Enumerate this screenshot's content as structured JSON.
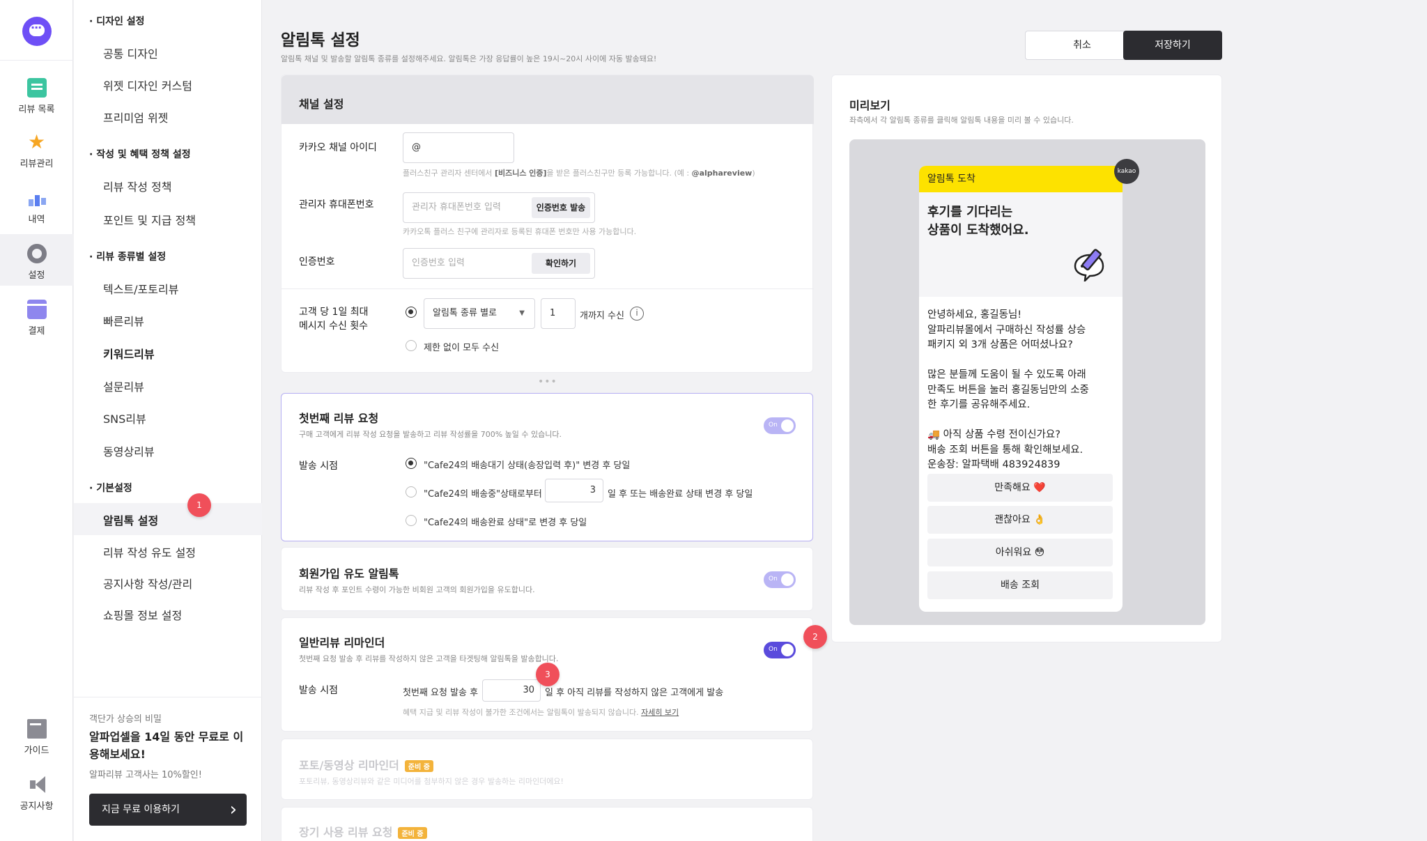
{
  "rail": {
    "items": [
      {
        "label": "리뷰 목록",
        "icon": "review-list-icon"
      },
      {
        "label": "리뷰관리",
        "icon": "star-icon"
      },
      {
        "label": "내역",
        "icon": "bar-chart-icon"
      },
      {
        "label": "설정",
        "icon": "gear-icon"
      },
      {
        "label": "결제",
        "icon": "card-icon"
      }
    ],
    "bottom": [
      {
        "label": "가이드",
        "icon": "book-icon"
      },
      {
        "label": "공지사항",
        "icon": "megaphone-icon"
      }
    ]
  },
  "menu": {
    "sections": [
      {
        "title": "· 디자인 설정",
        "items": [
          "공통 디자인",
          "위젯 디자인 커스텀",
          "프리미엄 위젯"
        ]
      },
      {
        "title": "· 작성 및 혜택 정책 설정",
        "items": [
          "리뷰 작성 정책",
          "포인트 및 지급 정책"
        ]
      },
      {
        "title": "· 리뷰 종류별 설정",
        "items": [
          "텍스트/포토리뷰",
          "빠른리뷰",
          "키워드리뷰",
          "설문리뷰",
          "SNS리뷰",
          "동영상리뷰"
        ]
      },
      {
        "title": "· 기본설정",
        "items": [
          "알림톡 설정",
          "리뷰 작성 유도 설정",
          "공지사항 작성/관리",
          "쇼핑몰 정보 설정"
        ]
      }
    ],
    "badge1": "1",
    "promo": {
      "small": "객단가 상승의 비밀",
      "big": "알파업셀을 14일 동안 무료로 이용해보세요!",
      "sub": "알파리뷰 고객사는 10%할인!",
      "cta": "지금 무료 이용하기"
    }
  },
  "header": {
    "title": "알림톡 설정",
    "desc": "알림톡 채널 및 발송할 알림톡 종류를 설정해주세요. 알림톡은 가장 응답률이 높은 19시~20시 사이에 자동 발송돼요!",
    "cancel": "취소",
    "save": "저장하기"
  },
  "channel": {
    "title": "채널 설정",
    "kakao_id_label": "카카오 채널 아이디",
    "kakao_id_value": "@",
    "kakao_hint_pre": "플러스친구 관리자 센터에서 ",
    "kakao_hint_bold": "[비즈니스 인증]",
    "kakao_hint_post": "을 받은 플러스친구만 등록 가능합니다. (예 : ",
    "kakao_hint_ex": "@alphareview",
    "kakao_hint_end": ")",
    "phone_label": "관리자 휴대폰번호",
    "phone_placeholder": "관리자 휴대폰번호 입력",
    "phone_btn": "인증번호 발송",
    "phone_hint": "카카오톡 플러스 친구에 관리자로 등록된 휴대폰 번호만 사용 가능합니다.",
    "code_label": "인증번호",
    "code_placeholder": "인증번호 입력",
    "code_btn": "확인하기",
    "limit_label_1": "고객 당 1일 최대",
    "limit_label_2": "메시지 수신 횟수",
    "limit_select": "알림톡 종류 별로",
    "limit_count": "1",
    "limit_suffix": "개까지 수신",
    "limit_unlimited": "제한 없이 모두 수신"
  },
  "first_review": {
    "title": "첫번째 리뷰 요청",
    "desc": "구매 고객에게 리뷰 작성 요청을 발송하고 리뷰 작성률을 700% 높일 수 있습니다.",
    "toggle": "On",
    "send_label": "발송 시점",
    "opt1": "\"Cafe24의 배송대기 상태(송장입력 후)\" 변경 후 당일",
    "opt2_pre": "\"Cafe24의 배송중\"상태로부터",
    "opt2_value": "3",
    "opt2_post": "일 후 또는 배송완료 상태 변경 후 당일",
    "opt3": "\"Cafe24의 배송완료 상태\"로 변경 후 당일"
  },
  "signup": {
    "title": "회원가입 유도 알림톡",
    "desc": "리뷰 작성 후 포인트 수령이 가능한 비회원 고객의 회원가입을 유도합니다.",
    "toggle": "On"
  },
  "reminder": {
    "title": "일반리뷰 리마인더",
    "desc": "첫번째 요청 발송 후 리뷰를 작성하지 않은 고객을 타겟팅해 알림톡을 발송합니다.",
    "toggle": "On",
    "badge2": "2",
    "badge3": "3",
    "send_label": "발송 시점",
    "pre": "첫번째 요청 발송 후",
    "days": "30",
    "post": "일 후 아직 리뷰를 작성하지 않은 고객에게 발송",
    "hint": "혜택 지급 및 리뷰 작성이 불가한 조건에서는 알림톡이 발송되지 않습니다.",
    "hint_link": "자세히 보기"
  },
  "photo_reminder": {
    "title": "포토/동영상 리마인더",
    "soon": "준비 중",
    "desc": "포토리뷰, 동영상리뷰와 같은 미디어를 첨부하지 않은 경우 발송하는 리마인더에요!"
  },
  "long_use": {
    "title": "장기 사용 리뷰 요청",
    "soon": "준비 중"
  },
  "preview": {
    "title": "미리보기",
    "desc": "좌측에서 각 알림톡 종류를 클릭해 알림톡 내용을 미리 볼 수 있습니다.",
    "kakao": "kakao",
    "top": "알림톡 도착",
    "headline_1": "후기를 기다리는",
    "headline_2": "상품이 도착했어요.",
    "body": [
      "안녕하세요, 홍길동님!",
      "알파리뷰몰에서 구매하신 작성률 상승",
      "패키지 외 3개 상품은 어떠셨나요?",
      "",
      "많은 분들께 도움이 될 수 있도록 아래",
      "만족도 버튼을 눌러 홍길동님만의 소중",
      "한 후기를 공유해주세요.",
      "",
      "🚚 아직 상품 수령 전이신가요?",
      "배송 조회 버튼을 통해 확인해보세요.",
      "운송장: 알파택배 483924839"
    ],
    "options": [
      "만족해요 ❤️",
      "괜찮아요 👌",
      "아쉬워요 😳",
      "배송 조회"
    ]
  },
  "colors": {
    "accent": "#6e4ff6",
    "toggle_on": "#5a4bdc",
    "kakao_yellow": "#fde200",
    "badge_red": "#f04f5a"
  }
}
